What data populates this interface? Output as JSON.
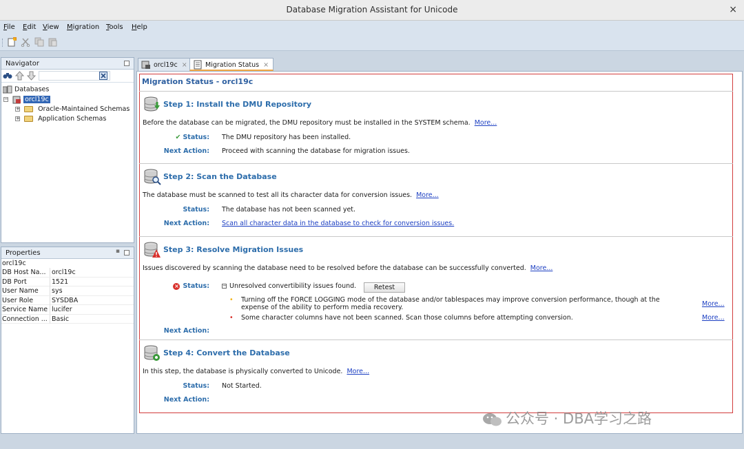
{
  "window": {
    "title": "Database Migration Assistant for Unicode",
    "close_glyph": "×"
  },
  "menu": [
    {
      "label": "File"
    },
    {
      "label": "Edit"
    },
    {
      "label": "View"
    },
    {
      "label": "Migration"
    },
    {
      "label": "Tools"
    },
    {
      "label": "Help"
    }
  ],
  "toolbar": {
    "icons": [
      "new-connection-icon",
      "cut-icon",
      "copy-icon",
      "paste-icon"
    ]
  },
  "navigator": {
    "title": "Navigator",
    "tree": {
      "root": "Databases",
      "db": "orcl19c",
      "children": [
        "Oracle-Maintained Schemas",
        "Application Schemas"
      ]
    }
  },
  "properties": {
    "title": "Properties",
    "subject": "orcl19c",
    "rows": [
      {
        "key": "DB Host Na...",
        "value": "orcl19c"
      },
      {
        "key": "DB Port",
        "value": "1521"
      },
      {
        "key": "User Name",
        "value": "sys"
      },
      {
        "key": "User Role",
        "value": "SYSDBA"
      },
      {
        "key": "Service Name",
        "value": "lucifer"
      },
      {
        "key": "Connection ...",
        "value": "Basic"
      }
    ]
  },
  "tabs": [
    {
      "label": "orcl19c",
      "active": false
    },
    {
      "label": "Migration Status",
      "active": true
    }
  ],
  "migration": {
    "title": "Migration Status - orcl19c",
    "status_label": "Status:",
    "next_label": "Next Action:",
    "more": "More...",
    "steps": [
      {
        "title": "Step 1: Install the DMU Repository",
        "description": "Before the database can be migrated, the DMU repository must be installed in the SYSTEM schema.",
        "status": "The DMU repository has been installed.",
        "status_icon": "check-icon",
        "next_action": "Proceed with scanning the database for migration issues."
      },
      {
        "title": "Step 2: Scan the Database",
        "description": "The database must be scanned to test all its character data for conversion issues.",
        "status": "The database has not been scanned yet.",
        "next_action": "Scan all character data in the database to check for conversion issues."
      },
      {
        "title": "Step 3: Resolve Migration Issues",
        "description": "Issues discovered by scanning the database need to be resolved before the database can be successfully converted.",
        "status": "Unresolved convertibility issues found.",
        "status_icon": "error-icon",
        "retest_label": "Retest",
        "issues": [
          {
            "text": "Turning off the FORCE LOGGING mode of the database and/or tablespaces may improve conversion performance, though at the expense of the ability to perform media recovery.",
            "severity_color": "#f2b316"
          },
          {
            "text": "Some character columns have not been scanned. Scan those columns before attempting conversion.",
            "severity_color": "#d9302b"
          }
        ],
        "next_action": ""
      },
      {
        "title": "Step 4: Convert the Database",
        "description": "In this step, the database is physically converted to Unicode.",
        "status": "Not Started.",
        "next_action": ""
      }
    ]
  },
  "watermark": "公众号 · DBA学习之路",
  "colors": {
    "accent": "#2d6dab",
    "link": "#1c3fc2",
    "highlight_border": "#d23b3b",
    "tab_indicator": "#f3a742"
  }
}
